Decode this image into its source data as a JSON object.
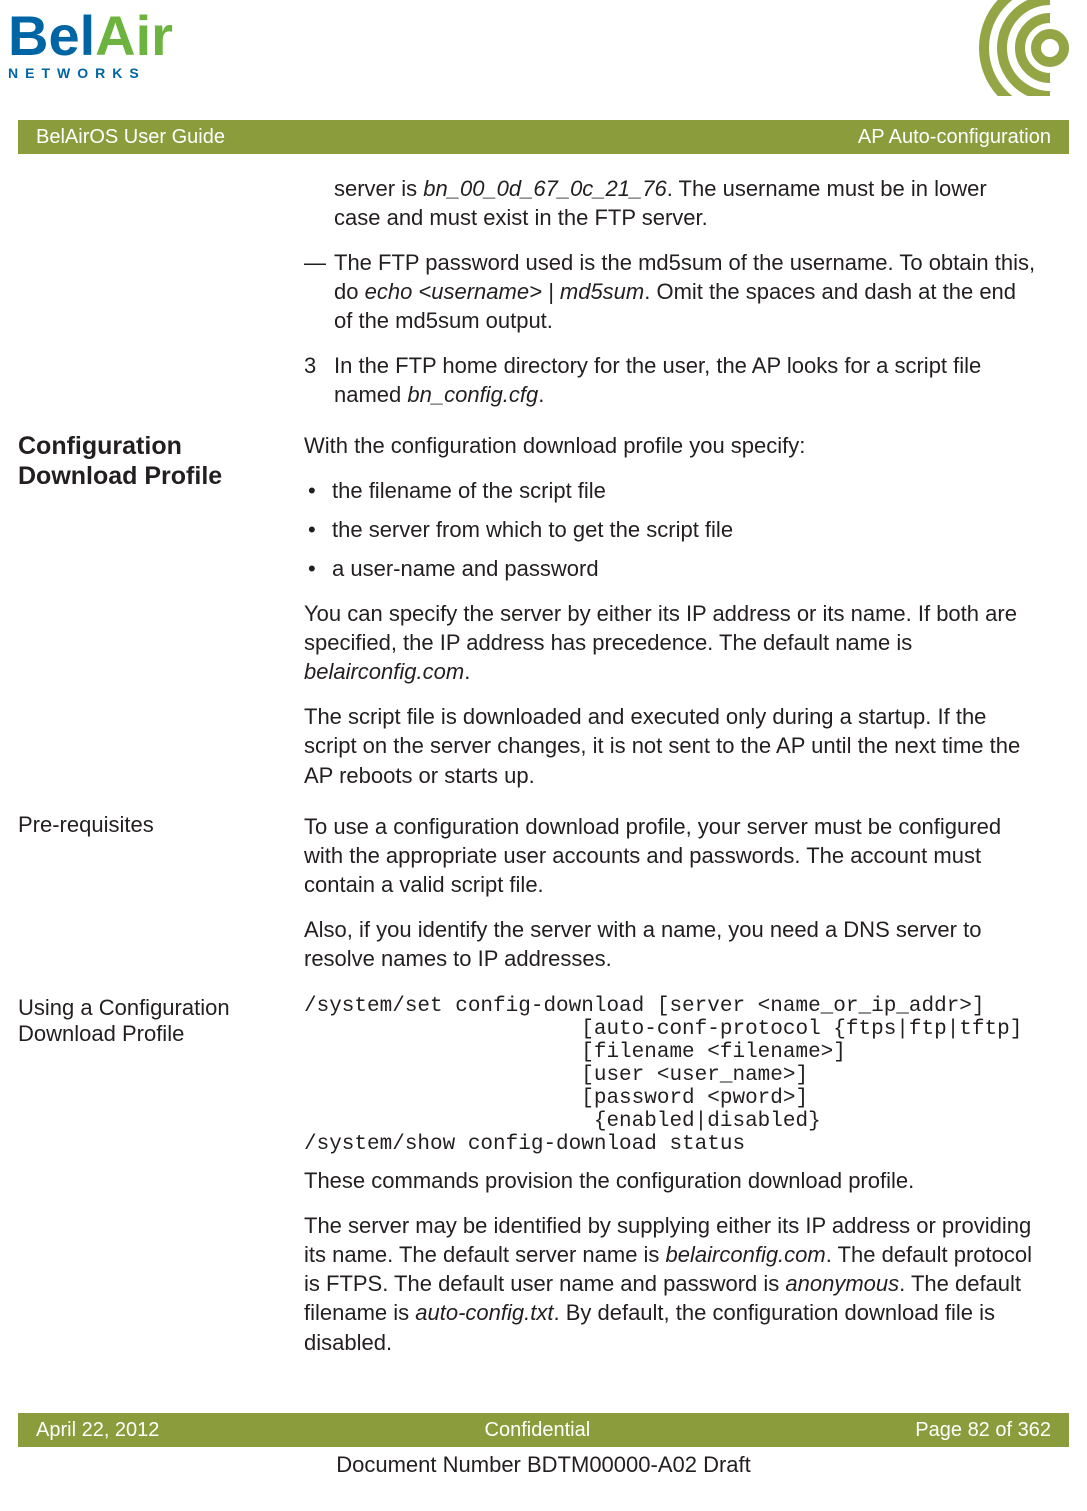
{
  "logo": {
    "part1": "Bel",
    "part2": "Air",
    "networks": "NETWORKS"
  },
  "bar": {
    "left": "BelAirOS User Guide",
    "right": "AP Auto-configuration"
  },
  "intro": {
    "cont1a": "server is ",
    "cont1b": "bn_00_0d_67_0c_21_76",
    "cont1c": ". The username must be in lower case and must exist in the FTP server.",
    "dash": "—",
    "cont2a": "The FTP password used is the md5sum of the username. To obtain this, do ",
    "cont2b": "echo <username> | md5sum",
    "cont2c": ". Omit the spaces and dash at the end of the md5sum output.",
    "step3num": "3",
    "step3a": "In the FTP home directory for the user, the AP looks for a script file named ",
    "step3b": "bn_config.cfg",
    "step3c": "."
  },
  "s1": {
    "title": "Configuration Download Profile",
    "p1": "With the configuration download profile you specify:",
    "b1": "the filename of the script file",
    "b2": "the server from which to get the script file",
    "b3": "a user-name and password",
    "p2a": "You can specify the server by either its IP address or its name. If both are specified, the IP address has precedence. The default name is ",
    "p2b": "belairconfig.com",
    "p2c": ".",
    "p3": "The script file is downloaded and executed only during a startup. If the script on the server changes, it is not sent to the AP until the next time the AP reboots or starts up."
  },
  "s2": {
    "title": "Pre-requisites",
    "p1": "To use a configuration download profile, your server must be configured with the appropriate user accounts and passwords. The account must contain a valid script file.",
    "p2": "Also, if you identify the server with a name, you need a DNS server to resolve names to IP addresses."
  },
  "s3": {
    "title": "Using a Configuration Download Profile",
    "code": "/system/set config-download [server <name_or_ip_addr>]\n                      [auto-conf-protocol {ftps|ftp|tftp]\n                      [filename <filename>]\n                      [user <user_name>]\n                      [password <pword>]\n                       {enabled|disabled}\n/system/show config-download status",
    "p1": "These commands provision the configuration download profile.",
    "p2a": "The server may be identified by supplying either its IP address or providing its name. The default server name is ",
    "p2b": "belairconfig.com",
    "p2c": ". The default protocol is FTPS. The default user name and password is ",
    "p2d": "anonymous",
    "p2e": ". The default filename is ",
    "p2f": "auto-config.txt",
    "p2g": ". By default, the configuration download file is disabled."
  },
  "footer": {
    "date": "April 22, 2012",
    "mid": "Confidential",
    "page": "Page 82 of 362",
    "docnum": "Document Number BDTM00000-A02 Draft"
  }
}
